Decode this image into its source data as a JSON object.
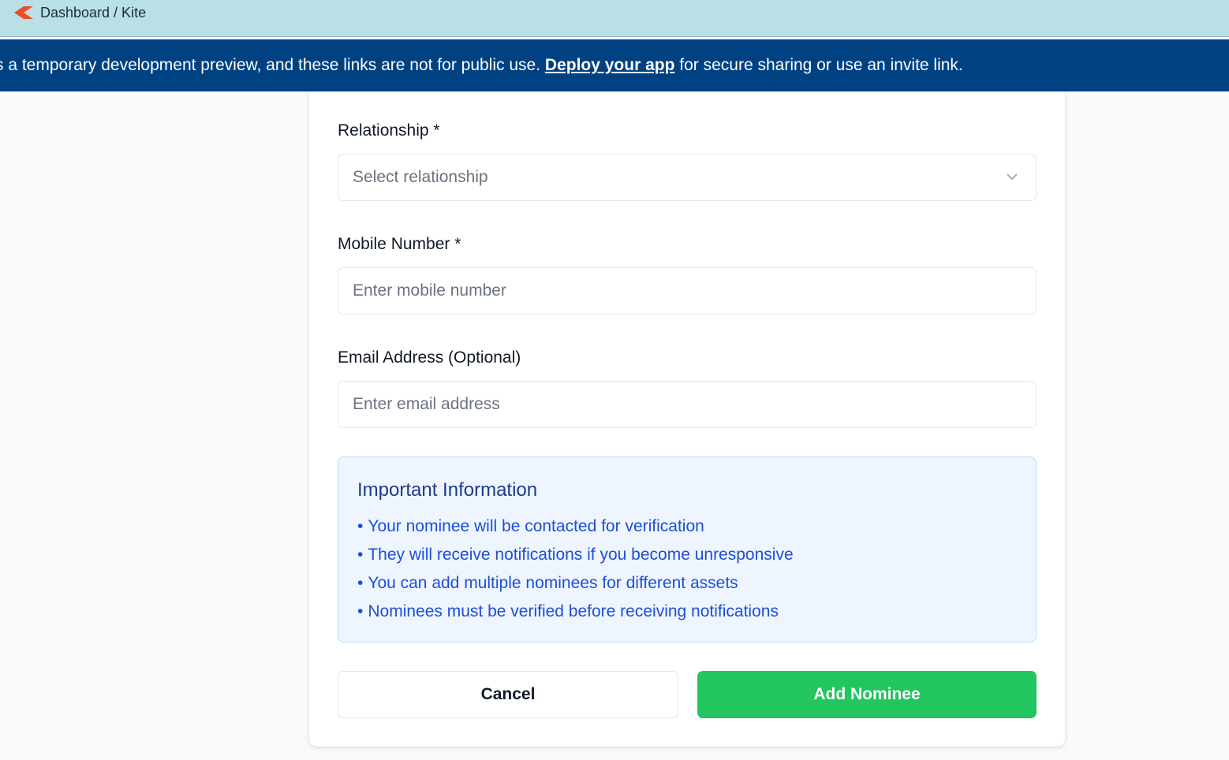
{
  "window": {
    "title": "Dashboard / Kite"
  },
  "banner": {
    "text_before": "s a temporary development preview, and these links are not for public use. ",
    "link_text": "Deploy your app",
    "text_after": " for secure sharing or use an invite link."
  },
  "form": {
    "relationship": {
      "label": "Relationship *",
      "placeholder": "Select relationship"
    },
    "mobile": {
      "label": "Mobile Number *",
      "placeholder": "Enter mobile number",
      "value": ""
    },
    "email": {
      "label": "Email Address (Optional)",
      "placeholder": "Enter email address",
      "value": ""
    }
  },
  "info": {
    "title": "Important Information",
    "bullet": "•",
    "items": [
      "Your nominee will be contacted for verification",
      "They will receive notifications if you become unresponsive",
      "You can add multiple nominees for different assets",
      "Nominees must be verified before receiving notifications"
    ]
  },
  "actions": {
    "cancel_label": "Cancel",
    "submit_label": "Add Nominee"
  },
  "colors": {
    "topbar": "#b8e0e5",
    "banner": "#004182",
    "accent_green": "#22c55e",
    "info_bg": "#eef5fe",
    "info_text": "#1d4ed8"
  },
  "icons": {
    "app_logo": "kite-logo-icon",
    "dropdown": "chevron-down-icon"
  }
}
